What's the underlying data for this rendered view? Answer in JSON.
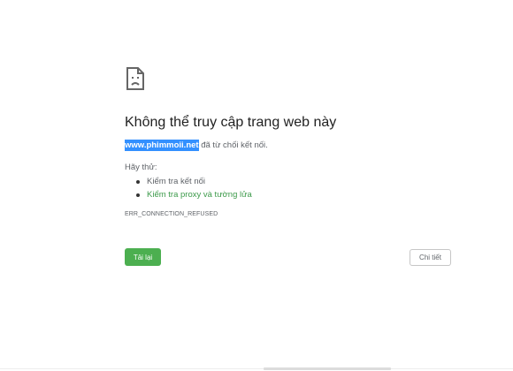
{
  "error_page": {
    "icon": "sad-page-icon",
    "title": "Không thể truy cập trang web này",
    "host": "www.phimmoii.net",
    "description_suffix": " đã từ chối kết nối.",
    "try_label": "Hãy thử:",
    "suggestions": [
      "Kiểm tra kết nối",
      "Kiểm tra proxy và tường lửa"
    ],
    "error_code": "ERR_CONNECTION_REFUSED",
    "reload_label": "Tải lại",
    "details_label": "Chi tiết"
  },
  "colors": {
    "host_highlight": "#3390ff",
    "link_green": "#3c9a4a",
    "reload_button": "#4caf50"
  }
}
